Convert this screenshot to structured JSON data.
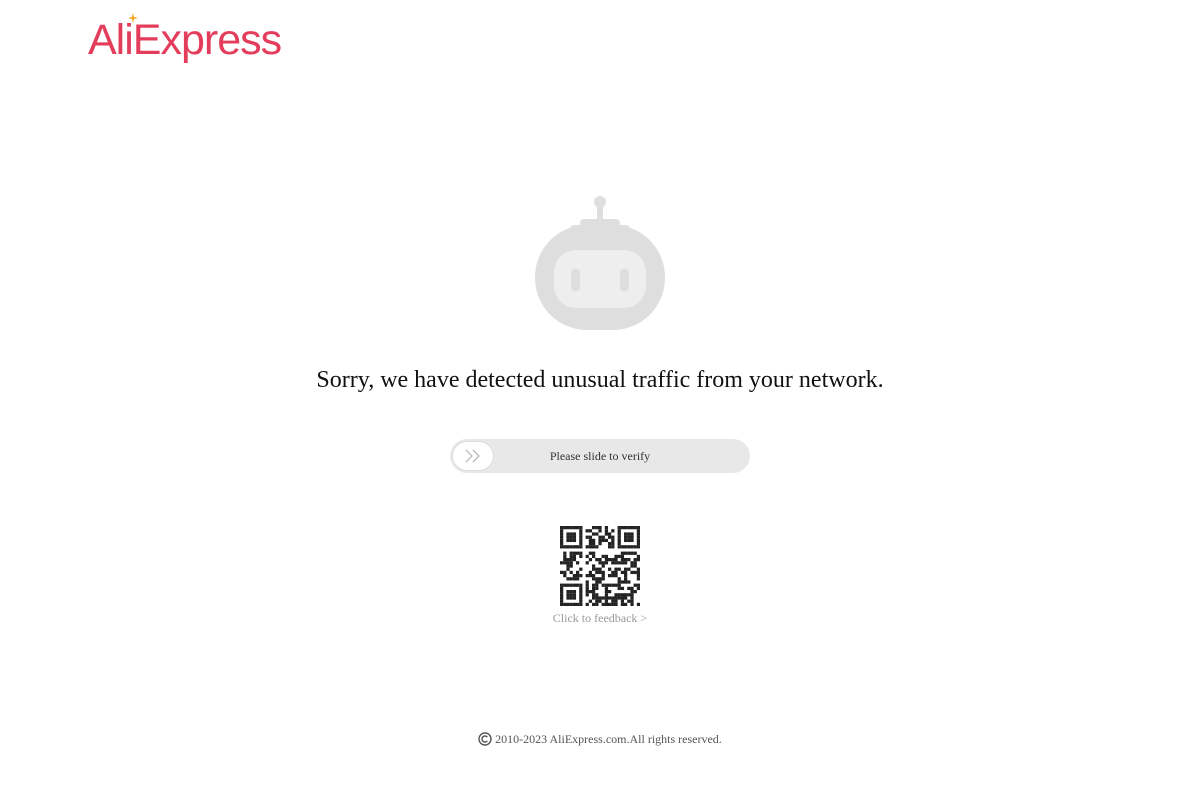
{
  "brand": {
    "logo_text": "AliExpress",
    "color": "#e43d5b"
  },
  "message": {
    "title": "Sorry, we have detected unusual traffic from your network."
  },
  "slider": {
    "label": "Please slide to verify",
    "handle_icon": "double-chevron-right-icon"
  },
  "feedback": {
    "label": "Click to feedback >"
  },
  "footer": {
    "copyright_icon": "copyright-icon",
    "text": "2010-2023 AliExpress.com.All rights reserved."
  },
  "colors": {
    "robot_gray": "#dedede",
    "slider_track": "#e8e8e8",
    "muted_text": "#999999"
  }
}
